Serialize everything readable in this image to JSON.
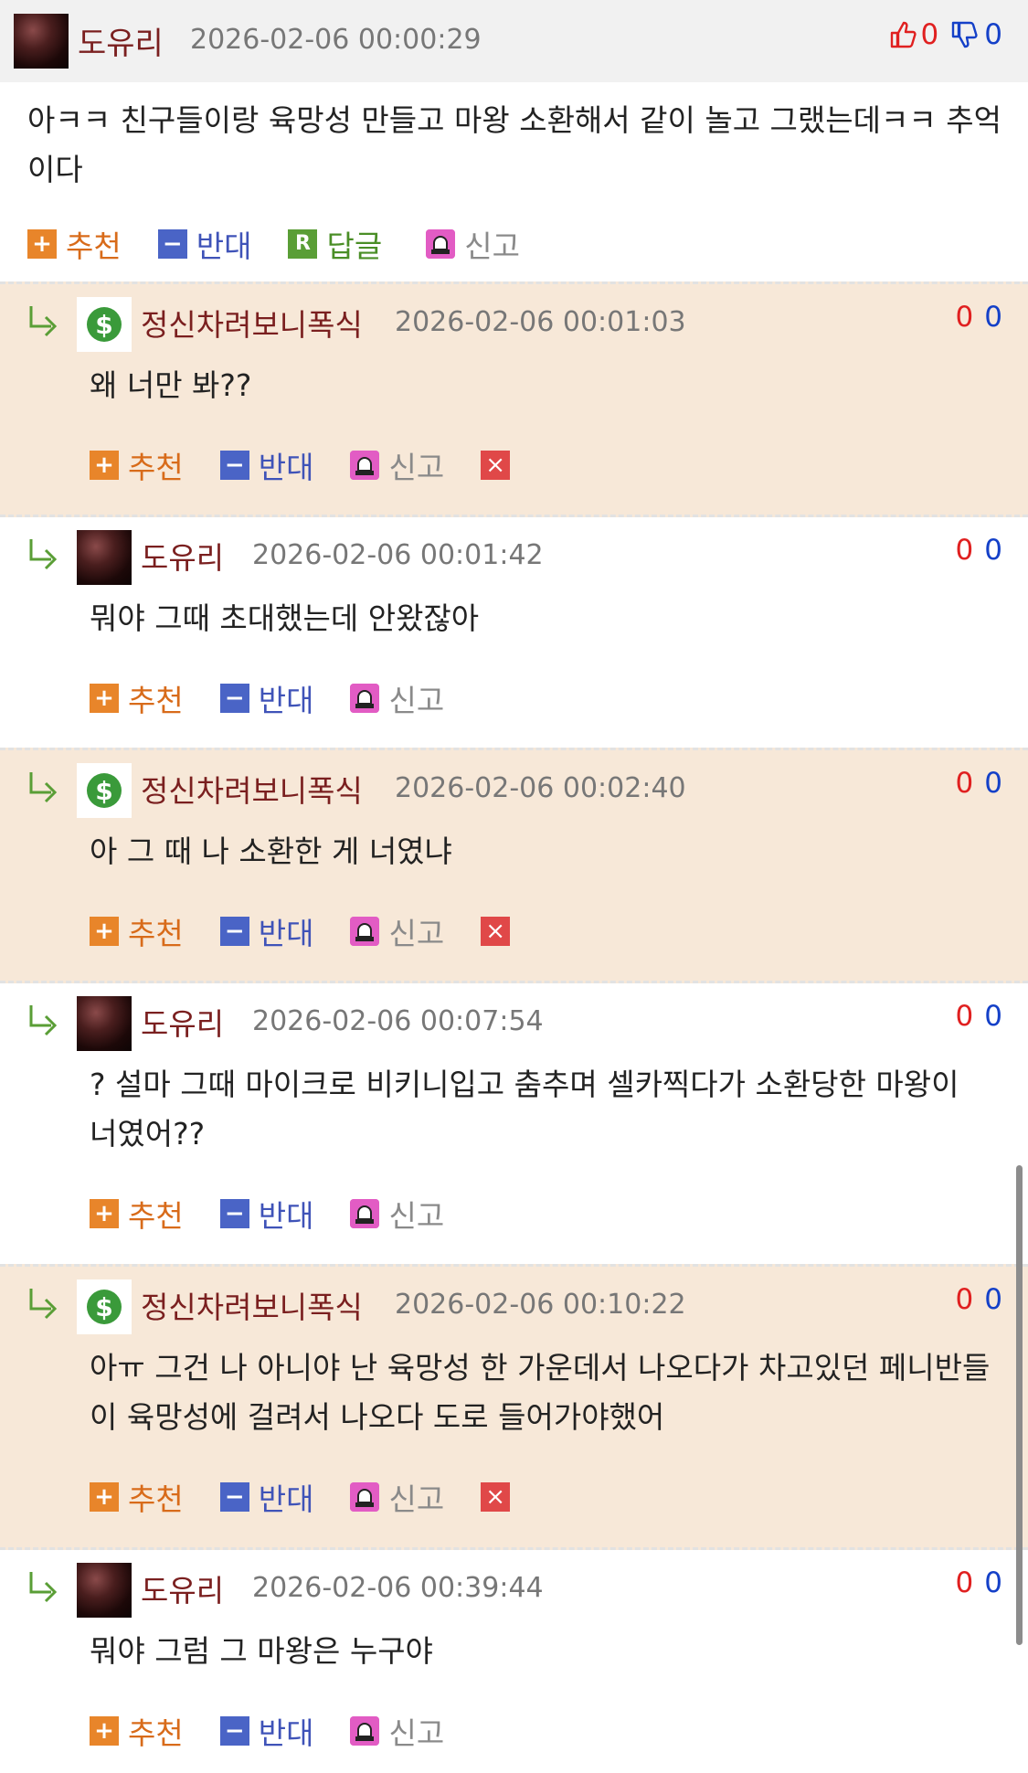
{
  "post": {
    "nickname": "도유리",
    "datetime": "2026-02-06 00:00:29",
    "up_count": "0",
    "down_count": "0",
    "text": "아ㅋㅋ 친구들이랑 육망성 만들고 마왕 소환해서 같이 놀고 그랬는데ㅋㅋ 추억이다",
    "actions": {
      "recommend": "추천",
      "oppose": "반대",
      "reply": "답글",
      "report": "신고",
      "reply_icon_letter": "R"
    }
  },
  "labels": {
    "recommend": "추천",
    "oppose": "반대",
    "report": "신고"
  },
  "comments": [
    {
      "nickname": "정신차려보니폭식",
      "avatar": "dollar-icon",
      "datetime": "2026-02-06 00:01:03",
      "red": "0",
      "blue": "0",
      "text": "왜 너만 봐??",
      "deletable": true
    },
    {
      "nickname": "도유리",
      "avatar": "user-photo",
      "datetime": "2026-02-06 00:01:42",
      "red": "0",
      "blue": "0",
      "text": "뭐야 그때 초대했는데 안왔잖아",
      "deletable": false
    },
    {
      "nickname": "정신차려보니폭식",
      "avatar": "dollar-icon",
      "datetime": "2026-02-06 00:02:40",
      "red": "0",
      "blue": "0",
      "text": "아 그 때 나 소환한 게 너였냐",
      "deletable": true
    },
    {
      "nickname": "도유리",
      "avatar": "user-photo",
      "datetime": "2026-02-06 00:07:54",
      "red": "0",
      "blue": "0",
      "text": "? 설마 그때 마이크로 비키니입고 춤추며 셀카찍다가 소환당한 마왕이 너였어??",
      "deletable": false
    },
    {
      "nickname": "정신차려보니폭식",
      "avatar": "dollar-icon",
      "datetime": "2026-02-06 00:10:22",
      "red": "0",
      "blue": "0",
      "text": "아ㅠ 그건 나 아니야 난 육망성 한 가운데서 나오다가 차고있던 페니반들이 육망성에 걸려서 나오다 도로 들어가야했어",
      "deletable": true
    },
    {
      "nickname": "도유리",
      "avatar": "user-photo",
      "datetime": "2026-02-06 00:39:44",
      "red": "0",
      "blue": "0",
      "text": "뭐야 그럼 그 마왕은 누구야",
      "deletable": false
    }
  ],
  "colors": {
    "header_bg": "#f1f1f1",
    "alt_comment_bg": "#f7e8d8",
    "nickname": "#7a1f1f",
    "date": "#777777",
    "up_red": "#e02020",
    "down_blue": "#1440c8",
    "recommend_orange": "#e8852a",
    "oppose_blue": "#4a64c6",
    "reply_green": "#5a9e36",
    "report_pink": "#e25cc4",
    "delete_red": "#e04848"
  }
}
